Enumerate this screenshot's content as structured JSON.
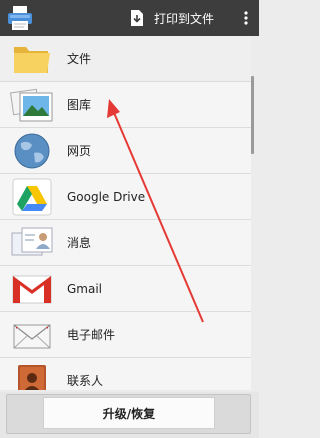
{
  "appbar": {
    "app_icon": "printer-app-icon",
    "print_label": "打印到文件",
    "print_icon": "file-download-icon",
    "overflow_icon": "overflow-menu-icon"
  },
  "list": {
    "items": [
      {
        "label": "文件",
        "icon": "folder-icon"
      },
      {
        "label": "图库",
        "icon": "gallery-icon"
      },
      {
        "label": "网页",
        "icon": "globe-icon"
      },
      {
        "label": "Google Drive",
        "icon": "google-drive-icon"
      },
      {
        "label": "消息",
        "icon": "messages-icon"
      },
      {
        "label": "Gmail",
        "icon": "gmail-icon"
      },
      {
        "label": "电子邮件",
        "icon": "email-envelope-icon"
      },
      {
        "label": "联系人",
        "icon": "contacts-book-icon"
      }
    ]
  },
  "bottom": {
    "upgrade_label": "升级/恢复"
  },
  "colors": {
    "appbar": "#3d3d3d",
    "annotation_arrow": "#e53935"
  }
}
